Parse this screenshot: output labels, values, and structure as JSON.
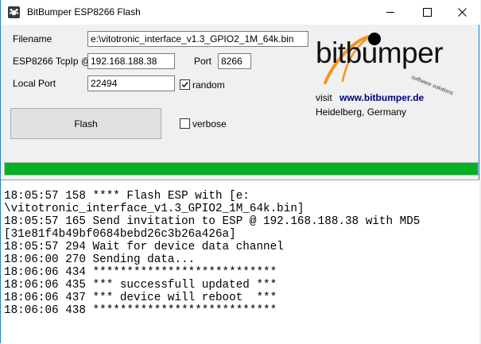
{
  "window": {
    "title": "BitBumper ESP8266 Flash"
  },
  "form": {
    "filename_label": "Filename",
    "filename_value": "e:\\vitotronic_interface_v1.3_GPIO2_1M_64k.bin",
    "tcpip_label": "ESP8266 TcpIp @",
    "tcpip_value": "192.168.188.38",
    "port_label": "Port",
    "port_value": "8266",
    "local_port_label": "Local Port",
    "local_port_value": "22494",
    "random_label": "random",
    "random_checked": true,
    "verbose_label": "verbose",
    "verbose_checked": false,
    "flash_label": "Flash"
  },
  "branding": {
    "logo_text": "bitbumper",
    "logo_subtext": "software solutions",
    "visit_label": "visit",
    "visit_link": "www.bitbumper.de",
    "location": "Heidelberg, Germany",
    "accent_color": "#f7941d"
  },
  "progress": {
    "value": 1.0,
    "color": "#06b025"
  },
  "console": {
    "lines": [
      "18:05:57 158 **** Flash ESP with [e:",
      "\\vitotronic_interface_v1.3_GPIO2_1M_64k.bin]",
      "18:05:57 165 Send invitation to ESP @ 192.168.188.38 with MD5",
      "[31e81f4b49bf0684bebd26c3b26a426a]",
      "18:05:57 294 Wait for device data channel",
      "18:06:00 270 Sending data...",
      "18:06:06 434 ***************************",
      "18:06:06 435 *** successfull updated ***",
      "18:06:06 437 *** device will reboot  ***",
      "18:06:06 438 ***************************"
    ]
  }
}
